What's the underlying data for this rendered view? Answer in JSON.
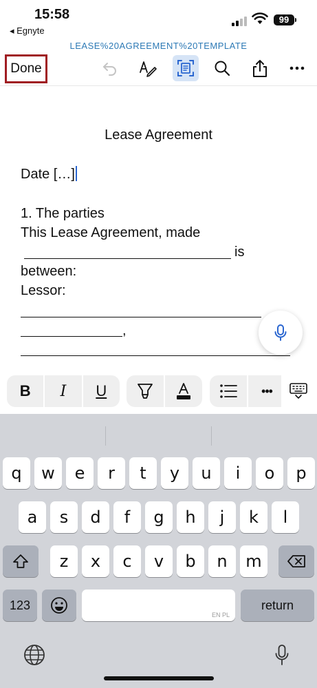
{
  "status_bar": {
    "time": "15:58",
    "back_app": "◂ Egnyte",
    "battery": "99"
  },
  "toolbar": {
    "filename": "LEASE%20AGREEMENT%20TEMPLATE",
    "done_label": "Done",
    "icons": [
      "undo-icon",
      "draw-icon",
      "reading-mode-icon",
      "search-icon",
      "share-icon",
      "more-icon"
    ]
  },
  "document": {
    "title": "Lease Agreement",
    "date_line": "Date […]",
    "section_heading": "1. The parties",
    "intro_line": "This Lease Agreement, made",
    "is_text": "is",
    "between_text": "between:",
    "lessor_label": "Lessor:",
    "comma": ","
  },
  "format_bar": {
    "bold": "B",
    "italic": "I",
    "underline": "U",
    "more": "•••"
  },
  "keyboard": {
    "row1": [
      "q",
      "w",
      "e",
      "r",
      "t",
      "y",
      "u",
      "i",
      "o",
      "p"
    ],
    "row2": [
      "a",
      "s",
      "d",
      "f",
      "g",
      "h",
      "j",
      "k",
      "l"
    ],
    "row3": [
      "z",
      "x",
      "c",
      "v",
      "b",
      "n",
      "m"
    ],
    "numbers_key": "123",
    "space_hint": "EN PL",
    "return_key": "return"
  }
}
